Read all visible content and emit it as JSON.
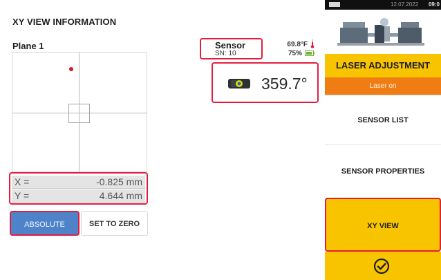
{
  "header": {
    "title": "XY VIEW INFORMATION"
  },
  "plane": {
    "label": "Plane 1"
  },
  "readout": {
    "x_label": "X =",
    "x_value": "-0.825 mm",
    "y_label": "Y =",
    "y_value": "4.644 mm"
  },
  "mode_buttons": {
    "absolute_label": "ABSOLUTE",
    "set_to_zero_label": "SET TO ZERO"
  },
  "sensor": {
    "name": "Sensor",
    "serial": "SN: 10",
    "temperature": "69.8°F",
    "battery": "75%",
    "angle": "359.7°"
  },
  "status_bar": {
    "time": "09:0",
    "date": "12.07.2022"
  },
  "sidebar": {
    "laser_adjustment": "LASER ADJUSTMENT",
    "laser_adjustment_sub": "Laser on",
    "sensor_list": "SENSOR LIST",
    "sensor_properties": "SENSOR PROPERTIES",
    "xy_view": "XY VIEW"
  },
  "icons": {
    "ok": "check-circle-icon",
    "sensor": "sensor-icon",
    "machine": "machine-train-icon",
    "thermometer": "thermometer-icon",
    "battery": "battery-icon"
  },
  "colors": {
    "accent_yellow": "#f8c400",
    "accent_orange": "#f07d14",
    "highlight_red": "#e21d3f",
    "button_blue": "#4f83c9",
    "laser_dot": "#e0162b"
  }
}
